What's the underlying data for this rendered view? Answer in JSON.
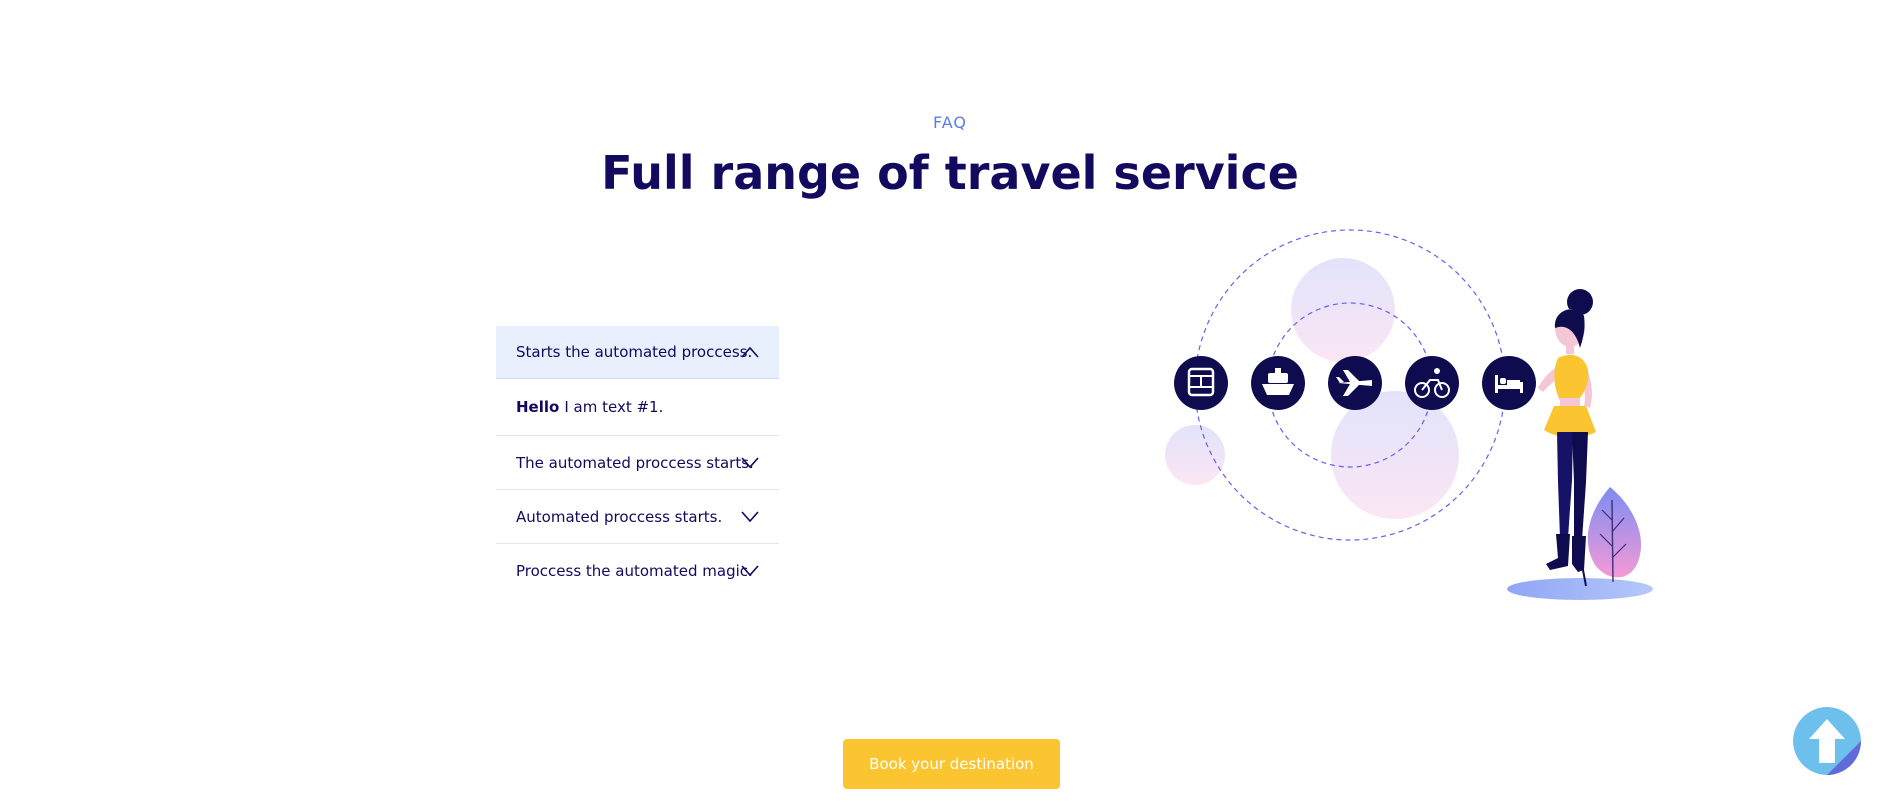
{
  "section": {
    "eyebrow": "FAQ",
    "title": "Full range of travel service"
  },
  "faq": {
    "items": [
      {
        "question": "Starts the automated proccess.",
        "open": true,
        "answer_bold": "Hello",
        "answer_rest": "I am text #1."
      },
      {
        "question": "The automated proccess starts.",
        "open": false
      },
      {
        "question": "Automated proccess starts.",
        "open": false
      },
      {
        "question": "Proccess the automated magic.",
        "open": false
      }
    ],
    "icons": {
      "open": "chevron-up-icon",
      "closed": "chevron-down-icon"
    }
  },
  "illustration": {
    "service_icons": [
      "bus-icon",
      "ship-icon",
      "airplane-icon",
      "bicycle-icon",
      "bed-icon"
    ]
  },
  "cta": {
    "label": "Book your destination"
  },
  "scroll_top": {
    "icon": "arrow-up-icon"
  },
  "colors": {
    "navy": "#120a5e",
    "accent_blue": "#5b7cf0",
    "cta_yellow": "#fbc531",
    "open_row_bg": "#e8f0fd",
    "scroll_top_bg": "#6ec0ec"
  }
}
